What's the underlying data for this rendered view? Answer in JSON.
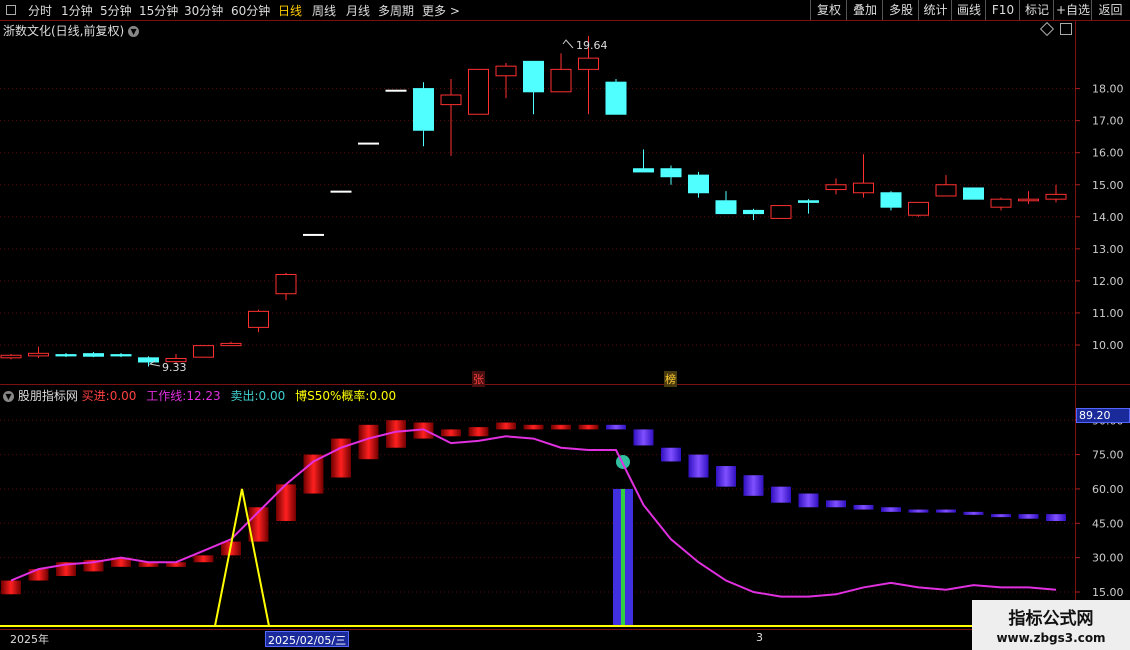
{
  "toolbar": {
    "periods": [
      "分时",
      "1分钟",
      "5分钟",
      "15分钟",
      "30分钟",
      "60分钟",
      "日线",
      "周线",
      "月线",
      "多周期",
      "更多"
    ],
    "active": "日线",
    "right_buttons": [
      "复权",
      "叠加",
      "多股",
      "统计",
      "画线",
      "F10",
      "标记",
      "+自选",
      "返回"
    ]
  },
  "kline": {
    "title": "浙数文化(日线,前复权)",
    "high_label": "19.64",
    "low_label": "9.33",
    "tag_zhang": "张",
    "tag_bang": "榜",
    "y_ticks": [
      "18.00",
      "17.00",
      "16.00",
      "15.00",
      "14.00",
      "13.00",
      "12.00",
      "11.00",
      "10.00"
    ]
  },
  "indicator": {
    "name": "股朋指标网",
    "buy_label": "买进:",
    "buy_value": "0.00",
    "work_label": "工作线:",
    "work_value": "12.23",
    "sell_label": "卖出:",
    "sell_value": "0.00",
    "prob_label": "博S50%概率:",
    "prob_value": "0.00",
    "y_ticks": [
      "90.00",
      "75.00",
      "60.00",
      "45.00",
      "30.00",
      "15.00"
    ],
    "current_value": "89.20"
  },
  "dates": {
    "year_label": "2025年",
    "cursor_label": "2025/02/05/三",
    "month_label": "3"
  },
  "watermark": {
    "line1": "指标公式网",
    "line2": "www.zbgs3.com"
  },
  "chart_data": [
    {
      "type": "candlestick",
      "title": "浙数文化(日线,前复权)",
      "ylim": [
        9.5,
        19.8
      ],
      "ohlc": [
        [
          9.6,
          9.72,
          9.55,
          9.68
        ],
        [
          9.66,
          9.95,
          9.6,
          9.74
        ],
        [
          9.7,
          9.75,
          9.62,
          9.66
        ],
        [
          9.73,
          9.78,
          9.62,
          9.65
        ],
        [
          9.7,
          9.75,
          9.62,
          9.66
        ],
        [
          9.6,
          9.65,
          9.33,
          9.47
        ],
        [
          9.48,
          9.72,
          9.4,
          9.58
        ],
        [
          9.62,
          9.98,
          9.62,
          9.98
        ],
        [
          9.98,
          10.1,
          9.98,
          10.05
        ],
        [
          10.55,
          11.1,
          10.4,
          11.05
        ],
        [
          11.6,
          12.25,
          11.4,
          12.2
        ],
        [
          13.45,
          13.45,
          13.45,
          13.45
        ],
        [
          14.8,
          14.8,
          14.8,
          14.8
        ],
        [
          16.3,
          16.3,
          16.3,
          16.3
        ],
        [
          17.95,
          17.95,
          17.95,
          17.95
        ],
        [
          18.0,
          18.2,
          16.2,
          16.7
        ],
        [
          17.5,
          18.3,
          15.9,
          17.8
        ],
        [
          17.2,
          18.6,
          17.2,
          18.6
        ],
        [
          18.4,
          18.8,
          17.7,
          18.7
        ],
        [
          18.85,
          18.85,
          17.2,
          17.9
        ],
        [
          17.9,
          19.1,
          17.9,
          18.6
        ],
        [
          18.6,
          19.64,
          17.2,
          18.95
        ],
        [
          18.2,
          18.3,
          17.2,
          17.2
        ],
        [
          15.5,
          16.1,
          15.4,
          15.4
        ],
        [
          15.5,
          15.6,
          15.0,
          15.25
        ],
        [
          15.3,
          15.4,
          14.6,
          14.75
        ],
        [
          14.5,
          14.8,
          14.1,
          14.1
        ],
        [
          14.2,
          14.25,
          13.9,
          14.1
        ],
        [
          13.95,
          14.35,
          13.95,
          14.35
        ],
        [
          14.5,
          14.55,
          14.1,
          14.45
        ],
        [
          14.85,
          15.2,
          14.7,
          15.0
        ],
        [
          14.75,
          15.95,
          14.6,
          15.05
        ],
        [
          14.75,
          14.8,
          14.2,
          14.3
        ],
        [
          14.05,
          14.45,
          14.0,
          14.45
        ],
        [
          14.65,
          15.3,
          14.65,
          15.0
        ],
        [
          14.9,
          14.9,
          14.55,
          14.55
        ],
        [
          14.3,
          14.6,
          14.2,
          14.55
        ],
        [
          14.5,
          14.8,
          14.4,
          14.55
        ],
        [
          14.55,
          15.0,
          14.45,
          14.7
        ]
      ]
    },
    {
      "type": "line",
      "title": "股朋指标网",
      "ylim": [
        5,
        95
      ],
      "series": [
        {
          "name": "工作线",
          "color": "#e030e0",
          "values": [
            20,
            25,
            27,
            28,
            30,
            28,
            28,
            33,
            38,
            50,
            62,
            72,
            78,
            82,
            85,
            86,
            80,
            81,
            83,
            82,
            78,
            77,
            77,
            53,
            38,
            28,
            20,
            15,
            13,
            13,
            14,
            17,
            19,
            17,
            16,
            18,
            17,
            17,
            16
          ]
        },
        {
          "name": "买进",
          "color": "#ffff00",
          "values": [
            5,
            5,
            5,
            5,
            5,
            5,
            5,
            5,
            5,
            5,
            5,
            5,
            5,
            5,
            5,
            5,
            5,
            5,
            5,
            5,
            5,
            5,
            5,
            5,
            5,
            5,
            5,
            5,
            5,
            5,
            5,
            5,
            5,
            5,
            5,
            5,
            5,
            5,
            5
          ]
        },
        {
          "name": "博S50%概率",
          "color": "#ffff00",
          "values": [
            0,
            0,
            0,
            0,
            0,
            0,
            0,
            0,
            60,
            0,
            0,
            0,
            0,
            0,
            0,
            0,
            0,
            0,
            0,
            0,
            0,
            0,
            0,
            0,
            0,
            0,
            0,
            0,
            0,
            0,
            0,
            0,
            0,
            0,
            0,
            0,
            0,
            0,
            0
          ]
        }
      ],
      "bars": [
        [
          14,
          20
        ],
        [
          20,
          25
        ],
        [
          22,
          28
        ],
        [
          24,
          29
        ],
        [
          26,
          30
        ],
        [
          26,
          28
        ],
        [
          26,
          28
        ],
        [
          28,
          31
        ],
        [
          31,
          37
        ],
        [
          37,
          52
        ],
        [
          46,
          62
        ],
        [
          58,
          75
        ],
        [
          65,
          82
        ],
        [
          73,
          88
        ],
        [
          78,
          90
        ],
        [
          82,
          89
        ],
        [
          83,
          86
        ],
        [
          83,
          87
        ],
        [
          86,
          89
        ],
        [
          86,
          88
        ],
        [
          86,
          88
        ],
        [
          86,
          88
        ],
        [
          86,
          88
        ],
        [
          79,
          86
        ],
        [
          72,
          78
        ],
        [
          65,
          75
        ],
        [
          61,
          70
        ],
        [
          57,
          66
        ],
        [
          54,
          61
        ],
        [
          52,
          58
        ],
        [
          52,
          55
        ],
        [
          51,
          53
        ],
        [
          50,
          52
        ],
        [
          50,
          51
        ],
        [
          50,
          51
        ],
        [
          49,
          50
        ],
        [
          48,
          49
        ],
        [
          47,
          49
        ],
        [
          46,
          49
        ]
      ],
      "bars_rising_count": 22,
      "signal_index": 22,
      "signal_value": 60
    }
  ]
}
